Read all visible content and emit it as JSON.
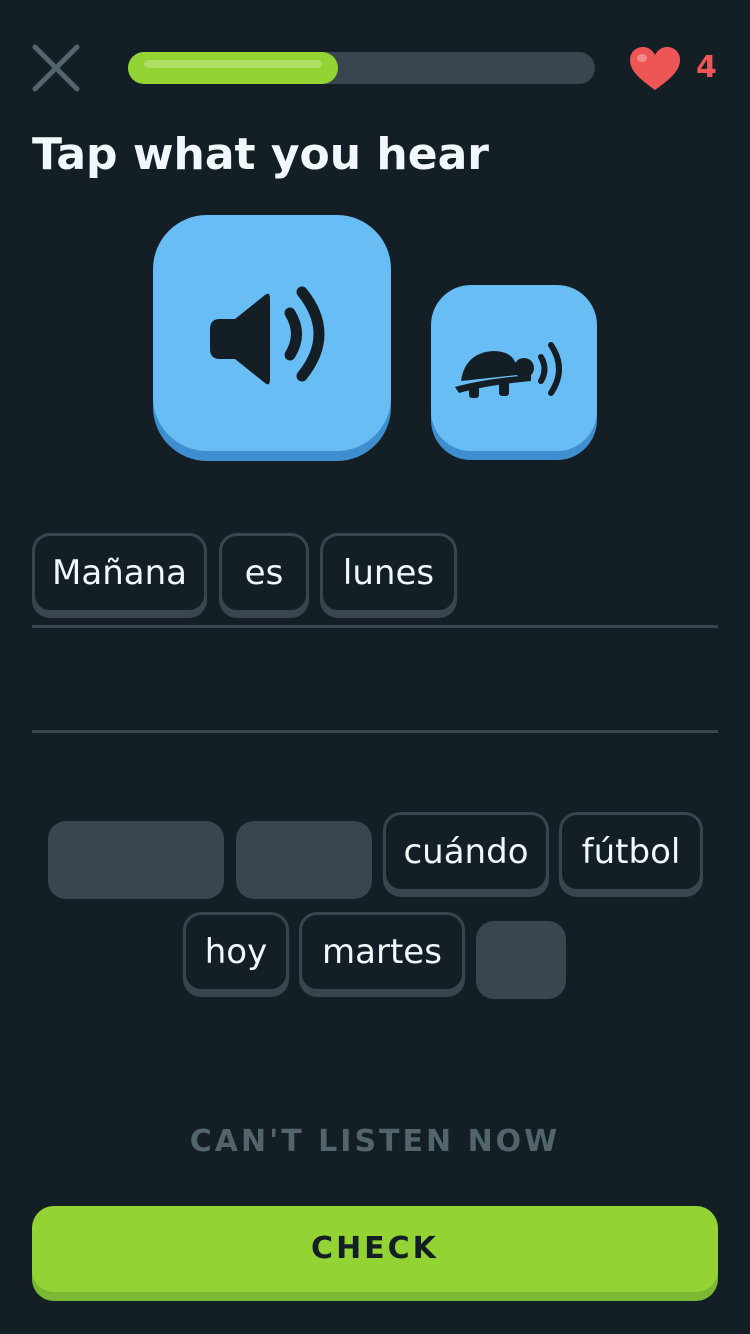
{
  "header": {
    "close_icon": "close-icon",
    "progress_fraction": 0.45,
    "hearts": "4",
    "heart_icon": "heart-icon"
  },
  "prompt": {
    "title": "Tap what you hear",
    "speaker_icon": "speaker-icon",
    "slow_icon": "turtle-speaker-icon"
  },
  "answer": {
    "selected_words": [
      "Mañana",
      "es",
      "lunes"
    ]
  },
  "word_bank": {
    "words": [
      "cuándo",
      "fútbol",
      "hoy",
      "martes"
    ]
  },
  "footer": {
    "cant_listen_label": "CAN'T LISTEN NOW",
    "check_label": "CHECK"
  },
  "colors": {
    "background": "#131f24",
    "accent_green": "#93d333",
    "accent_blue": "#69bdf5",
    "border_gray": "#37464f",
    "heart_red": "#ee5555"
  }
}
